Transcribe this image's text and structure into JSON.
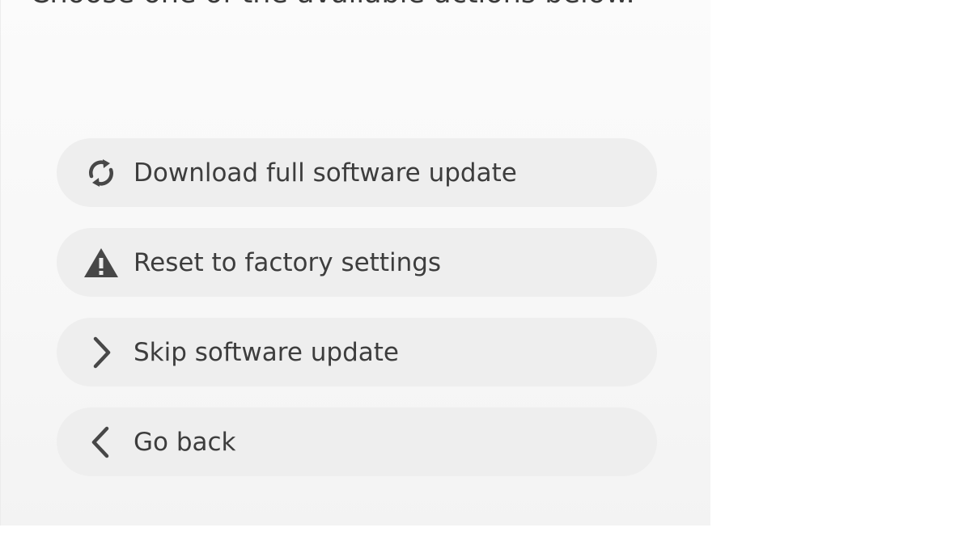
{
  "intro": {
    "text": "Choose one of the available actions below."
  },
  "actions": [
    {
      "label": "Download full software update",
      "icon": "refresh-icon"
    },
    {
      "label": "Reset to factory settings",
      "icon": "warning-icon"
    },
    {
      "label": "Skip software update",
      "icon": "chevron-right-icon"
    },
    {
      "label": "Go back",
      "icon": "chevron-left-icon"
    }
  ],
  "colors": {
    "panel_background": "#f7f7f7",
    "button_background": "#eeeeee",
    "text": "#3d3d3d"
  }
}
